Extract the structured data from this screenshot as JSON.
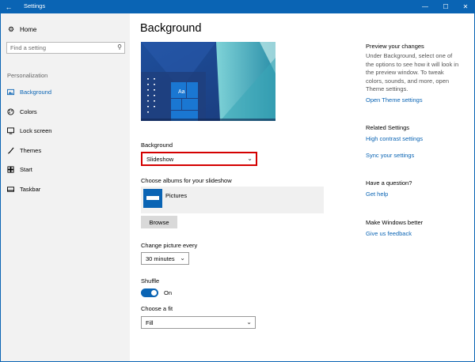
{
  "window": {
    "title": "Settings",
    "accent": "#0a64b4"
  },
  "titlebar": {
    "back_icon": "back-arrow-icon",
    "minimize_icon": "minimize-icon",
    "maximize_icon": "maximize-icon",
    "close_icon": "close-icon"
  },
  "sidebar": {
    "home_label": "Home",
    "search_placeholder": "Find a setting",
    "section_header": "Personalization",
    "items": [
      {
        "label": "Background",
        "icon": "picture-icon",
        "active": true
      },
      {
        "label": "Colors",
        "icon": "palette-icon",
        "active": false
      },
      {
        "label": "Lock screen",
        "icon": "lock-screen-icon",
        "active": false
      },
      {
        "label": "Themes",
        "icon": "brush-icon",
        "active": false
      },
      {
        "label": "Start",
        "icon": "start-icon",
        "active": false
      },
      {
        "label": "Taskbar",
        "icon": "taskbar-icon",
        "active": false
      }
    ]
  },
  "main": {
    "title": "Background",
    "preview_sample_text": "Aa",
    "background_label": "Background",
    "background_value": "Slideshow",
    "albums_label": "Choose albums for your slideshow",
    "album_name": "Pictures",
    "browse_label": "Browse",
    "change_label": "Change picture every",
    "change_value": "30 minutes",
    "shuffle_label": "Shuffle",
    "shuffle_state": "On",
    "fit_label": "Choose a fit",
    "fit_value": "Fill"
  },
  "right_panel": {
    "preview_header": "Preview your changes",
    "preview_lines": [
      "Under Background, select one of",
      "the options to see how it will look in",
      "the preview window. To tweak",
      "colors, sounds, and more, open",
      "Theme settings."
    ],
    "theme_link": "Open Theme settings",
    "related_header": "Related Settings",
    "high_contrast_link": "High contrast settings",
    "sync_link": "Sync your settings",
    "question_header": "Have a question?",
    "help_link": "Get help",
    "better_header": "Make Windows better",
    "feedback_link": "Give us feedback"
  }
}
